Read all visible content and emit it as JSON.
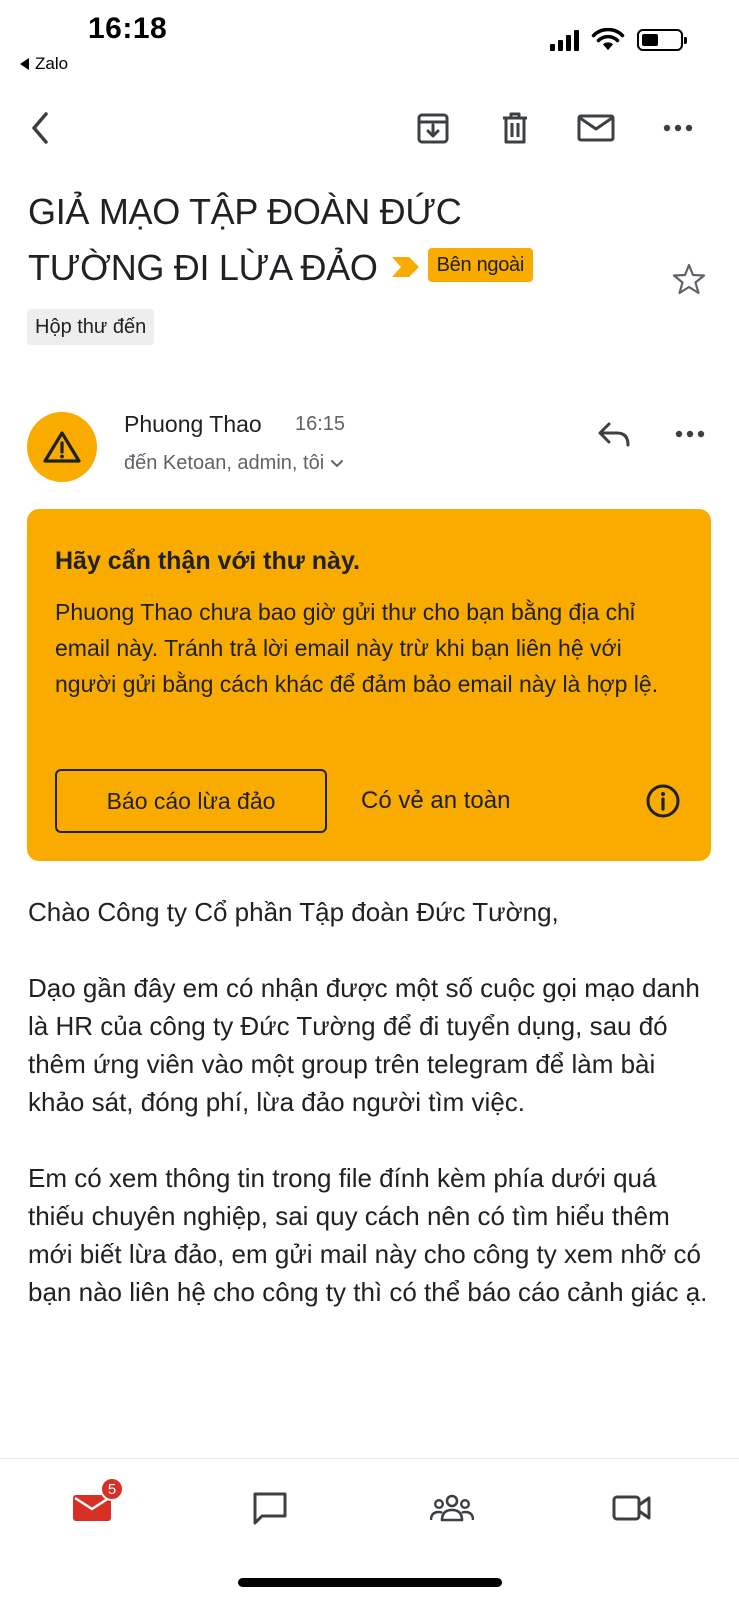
{
  "status_bar": {
    "time": "16:18",
    "back_app": "Zalo",
    "battery_level": 0.45
  },
  "toolbar": {
    "icons": [
      "back-arrow-icon",
      "archive-icon",
      "trash-icon",
      "mail-icon",
      "more-icon"
    ]
  },
  "email": {
    "subject_line1": "GIẢ MẠO TẬP ĐOÀN ĐỨC",
    "subject_line2": "TƯỜNG ĐI LỪA ĐẢO",
    "external_badge": "Bên ngoài",
    "label": "Hộp thư đến",
    "sender_name": "Phuong Thao",
    "time": "16:15",
    "recipients": "đến Ketoan, admin, tôi"
  },
  "warning": {
    "title": "Hãy cẩn thận với thư này.",
    "body": "Phuong Thao chưa bao giờ gửi thư cho bạn bằng địa chỉ email này. Tránh trả lời email này trừ khi bạn liên hệ với người gửi bằng cách khác để đảm bảo email này là hợp lệ.",
    "report_button": "Báo cáo lừa đảo",
    "safe_button": "Có vẻ an toàn"
  },
  "body": {
    "paragraphs": [
      "Chào Công ty Cổ phần Tập đoàn Đức Tường,",
      "Dạo gần đây em có nhận được một số cuộc gọi mạo danh là HR của công ty Đức Tường để đi tuyển dụng, sau đó thêm ứng viên vào một group trên telegram để làm bài khảo sát, đóng phí, lừa đảo người tìm việc.",
      "Em có xem thông tin trong file đính kèm phía dưới quá thiếu chuyên nghiệp, sai quy cách nên có tìm hiểu thêm mới biết lừa đảo, em gửi mail này cho công ty xem nhỡ có bạn nào liên hệ cho công ty thì có thể báo cáo cảnh giác ạ."
    ]
  },
  "bottom_nav": {
    "mail_badge": "5"
  },
  "colors": {
    "warning_bg": "#f9ab00",
    "badge_red": "#d93025",
    "mail_red": "#d93025",
    "text": "#202124",
    "secondary_text": "#5f6368"
  }
}
